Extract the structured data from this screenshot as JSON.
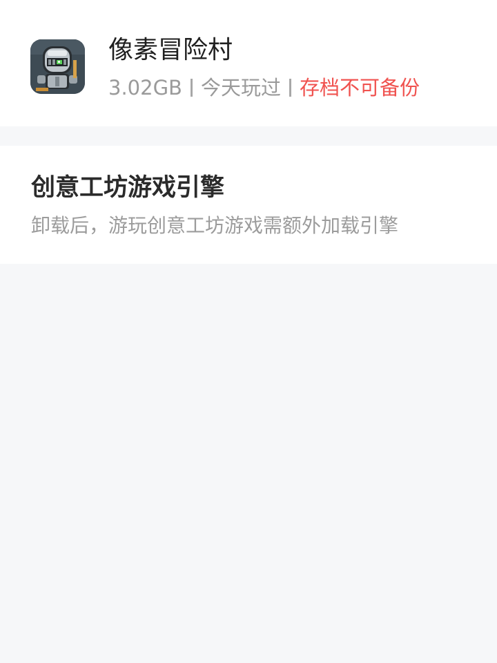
{
  "app": {
    "name": "像素冒险村",
    "size": "3.02GB",
    "last_played": "今天玩过",
    "backup_status": "存档不可备份",
    "icon": "pixel-knight-game-icon",
    "colors": {
      "warning": "#f0524f",
      "secondary_text": "#9a9a9a"
    }
  },
  "engine": {
    "title": "创意工坊游戏引擎",
    "description": "卸载后，游玩创意工坊游戏需额外加载引擎"
  }
}
